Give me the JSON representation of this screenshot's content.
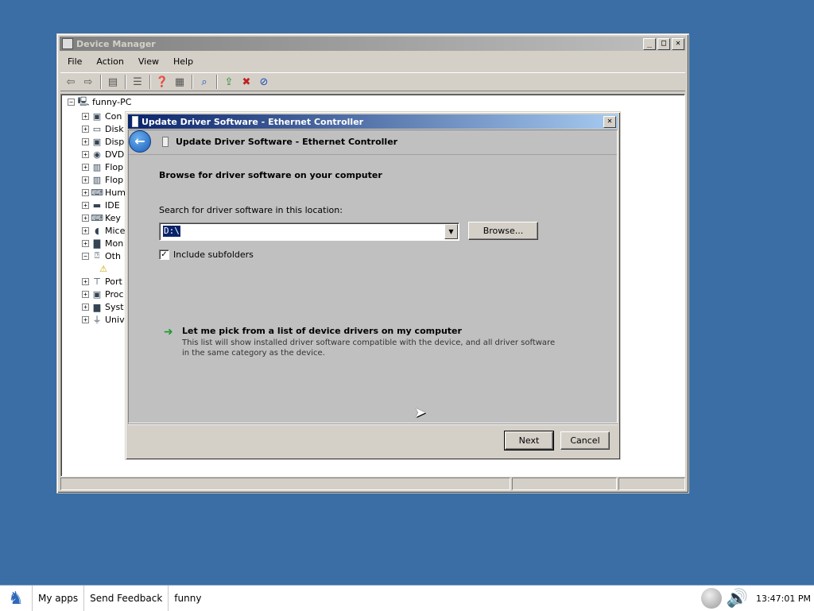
{
  "device_manager": {
    "title": "Device Manager",
    "menu": [
      "File",
      "Action",
      "View",
      "Help"
    ],
    "toolbar_icons": [
      "back-arrow-icon",
      "forward-arrow-icon",
      "properties-icon",
      "list-icon",
      "help-icon",
      "view-icon",
      "scan-hardware-icon",
      "update-driver-icon",
      "uninstall-icon",
      "disable-icon"
    ],
    "tree": {
      "root": "funny-PC",
      "items": [
        {
          "label": "Con",
          "icon": "computer-icon",
          "expander": "+"
        },
        {
          "label": "Disk",
          "icon": "disk-drive-icon",
          "expander": "+"
        },
        {
          "label": "Disp",
          "icon": "display-adapter-icon",
          "expander": "+"
        },
        {
          "label": "DVD",
          "icon": "dvd-icon",
          "expander": "+"
        },
        {
          "label": "Flop",
          "icon": "floppy-controller-icon",
          "expander": "+"
        },
        {
          "label": "Flop",
          "icon": "floppy-drive-icon",
          "expander": "+"
        },
        {
          "label": "Hum",
          "icon": "hid-icon",
          "expander": "+"
        },
        {
          "label": "IDE",
          "icon": "ide-controller-icon",
          "expander": "+"
        },
        {
          "label": "Key",
          "icon": "keyboard-icon",
          "expander": "+"
        },
        {
          "label": "Mice",
          "icon": "mouse-icon",
          "expander": "+"
        },
        {
          "label": "Mon",
          "icon": "monitor-icon",
          "expander": "+"
        },
        {
          "label": "Oth",
          "icon": "other-devices-icon",
          "expander": "−"
        },
        {
          "label": "",
          "icon": "warning-device-icon",
          "expander": ""
        },
        {
          "label": "Port",
          "icon": "port-icon",
          "expander": "+"
        },
        {
          "label": "Proc",
          "icon": "processor-icon",
          "expander": "+"
        },
        {
          "label": "Syst",
          "icon": "system-devices-icon",
          "expander": "+"
        },
        {
          "label": "Univ",
          "icon": "usb-icon",
          "expander": "+"
        }
      ]
    }
  },
  "dialog": {
    "title": "Update Driver Software - Ethernet Controller",
    "header_title": "Update Driver Software - Ethernet Controller",
    "heading": "Browse for driver software on your computer",
    "location_label": "Search for driver software in this location:",
    "location_value": "D:\\",
    "browse_label": "Browse...",
    "include_subfolders_label": "Include subfolders",
    "include_subfolders_checked": true,
    "pick_title": "Let me pick from a list of device drivers on my computer",
    "pick_desc": "This list will show installed driver software compatible with the device, and all driver software in the same category as the device.",
    "next_label": "Next",
    "cancel_label": "Cancel"
  },
  "taskbar": {
    "items": [
      "My apps",
      "Send Feedback",
      "funny"
    ],
    "clock": "13:47:01 PM"
  }
}
